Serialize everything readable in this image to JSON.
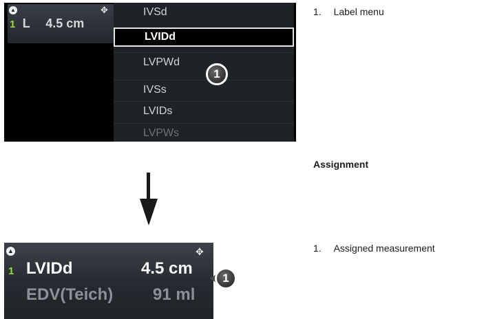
{
  "top_screen": {
    "measurement": {
      "index": "1",
      "label": "L",
      "value": "4.5 cm"
    },
    "label_menu": {
      "items": [
        {
          "label": "IVSd",
          "selected": false
        },
        {
          "label": "LVIDd",
          "selected": true
        },
        {
          "label": "LVPWd",
          "selected": false
        },
        {
          "label": "IVSs",
          "selected": false
        },
        {
          "label": "LVIDs",
          "selected": false
        },
        {
          "label": "LVPWs",
          "selected": false
        }
      ]
    },
    "callout_number": "1"
  },
  "bottom_screen": {
    "rows": [
      {
        "index": "1",
        "label": "LVIDd",
        "value": "4.5 cm"
      },
      {
        "index": "",
        "label": "EDV(Teich)",
        "value": "91 ml"
      }
    ],
    "callout_number": "1"
  },
  "notes": {
    "top_item": "Label menu",
    "top_item_number": "1.",
    "section_heading": "Assignment",
    "bottom_item": "Assigned measurement",
    "bottom_item_number": "1."
  },
  "colors": {
    "measurement_index": "#9bdc3a",
    "menu_background": "#1f2226",
    "selection_border": "#e6e6e6"
  },
  "icons": [
    "collapse-up-icon",
    "move-icon",
    "down-arrow-icon",
    "callout-badge-icon"
  ]
}
